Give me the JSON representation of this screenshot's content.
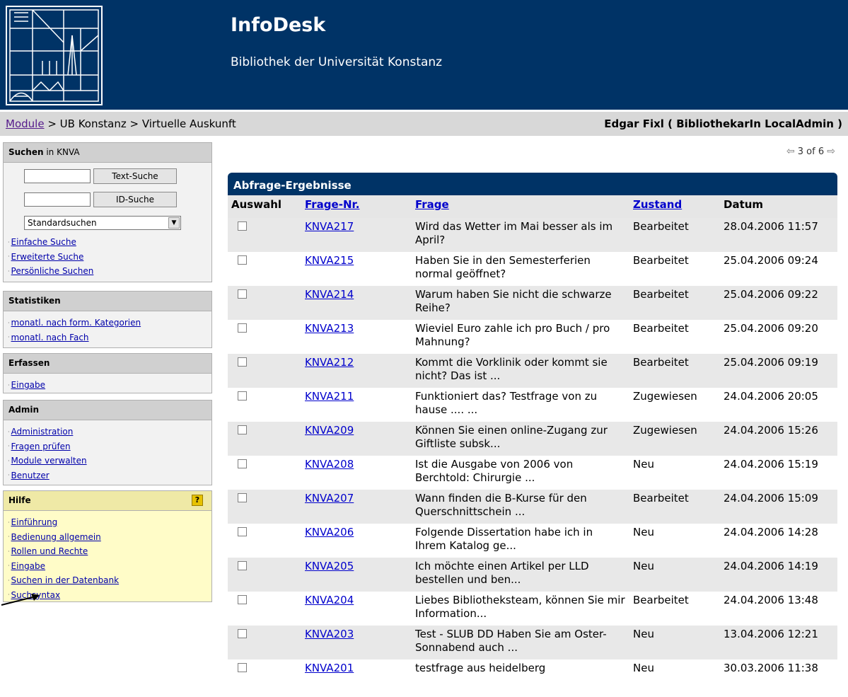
{
  "header": {
    "title": "InfoDesk",
    "subtitle": "Bibliothek der Universität Konstanz"
  },
  "breadcrumb": {
    "module_link": "Module",
    "rest": " > UB Konstanz > Virtuelle Auskunft"
  },
  "user_info": "Edgar Fixl ( BibliothekarIn LocalAdmin )",
  "sidebar": {
    "search": {
      "heading": "Suchen",
      "heading_sub": " in KNVA",
      "text_search_btn": "Text-Suche",
      "id_search_btn": "ID-Suche",
      "select_value": "Standardsuchen",
      "links": [
        "Einfache Suche",
        "Erweiterte Suche",
        "Persönliche Suchen"
      ]
    },
    "stats": {
      "heading": "Statistiken",
      "links": [
        "monatl. nach form. Kategorien",
        "monatl. nach Fach"
      ]
    },
    "erfassen": {
      "heading": "Erfassen",
      "links": [
        "Eingabe"
      ]
    },
    "admin": {
      "heading": "Admin",
      "links": [
        "Administration",
        "Fragen prüfen",
        "Module verwalten",
        "Benutzer"
      ]
    },
    "help": {
      "heading": "Hilfe",
      "icon": "help-question-icon",
      "links": [
        "Einführung",
        "Bedienung allgemein",
        "Rollen und Rechte",
        "Eingabe",
        "Suchen in der Datenbank",
        "Suchsyntax"
      ]
    }
  },
  "pager": {
    "text": "3 of 6",
    "prev_icon": "arrow-left-icon",
    "next_icon": "arrow-right-icon"
  },
  "results": {
    "title": "Abfrage-Ergebnisse",
    "columns": [
      "Auswahl",
      "Frage-Nr.",
      "Frage",
      "Zustand",
      "Datum"
    ],
    "rows": [
      {
        "nr": "KNVA217",
        "frage": "Wird das Wetter im Mai besser als im April?",
        "zustand": "Bearbeitet",
        "datum": "28.04.2006 11:57"
      },
      {
        "nr": "KNVA215",
        "frage": "Haben Sie in den Semesterferien normal geöffnet?",
        "zustand": "Bearbeitet",
        "datum": "25.04.2006 09:24"
      },
      {
        "nr": "KNVA214",
        "frage": "Warum haben Sie nicht die schwarze Reihe?",
        "zustand": "Bearbeitet",
        "datum": "25.04.2006 09:22"
      },
      {
        "nr": "KNVA213",
        "frage": "Wieviel Euro zahle ich pro Buch / pro Mahnung?",
        "zustand": "Bearbeitet",
        "datum": "25.04.2006 09:20"
      },
      {
        "nr": "KNVA212",
        "frage": "Kommt die Vorklinik oder kommt sie nicht? Das ist ...",
        "zustand": "Bearbeitet",
        "datum": "25.04.2006 09:19"
      },
      {
        "nr": "KNVA211",
        "frage": "Funktioniert das? Testfrage von zu hause .... ...",
        "zustand": "Zugewiesen",
        "datum": "24.04.2006 20:05"
      },
      {
        "nr": "KNVA209",
        "frage": "Können Sie einen online-Zugang zur Giftliste subsk...",
        "zustand": "Zugewiesen",
        "datum": "24.04.2006 15:26"
      },
      {
        "nr": "KNVA208",
        "frage": "Ist die Ausgabe von 2006 von Berchtold: Chirurgie ...",
        "zustand": "Neu",
        "datum": "24.04.2006 15:19"
      },
      {
        "nr": "KNVA207",
        "frage": "Wann finden die B-Kurse für den Querschnittschein ...",
        "zustand": "Bearbeitet",
        "datum": "24.04.2006 15:09"
      },
      {
        "nr": "KNVA206",
        "frage": "Folgende Dissertation habe ich in Ihrem Katalog ge...",
        "zustand": "Neu",
        "datum": "24.04.2006 14:28"
      },
      {
        "nr": "KNVA205",
        "frage": "Ich möchte einen Artikel per LLD bestellen und ben...",
        "zustand": "Neu",
        "datum": "24.04.2006 14:19"
      },
      {
        "nr": "KNVA204",
        "frage": "Liebes Bibliotheksteam, können Sie mir Information...",
        "zustand": "Bearbeitet",
        "datum": "24.04.2006 13:48"
      },
      {
        "nr": "KNVA203",
        "frage": "Test - SLUB DD Haben Sie am Oster-Sonnabend auch ...",
        "zustand": "Neu",
        "datum": "13.04.2006 12:21"
      },
      {
        "nr": "KNVA201",
        "frage": "testfrage aus heidelberg",
        "zustand": "Neu",
        "datum": "30.03.2006 11:38"
      }
    ]
  },
  "colors": {
    "header_bg": "#003366",
    "link": "#0000cc",
    "help_bg": "#fffcc8"
  }
}
